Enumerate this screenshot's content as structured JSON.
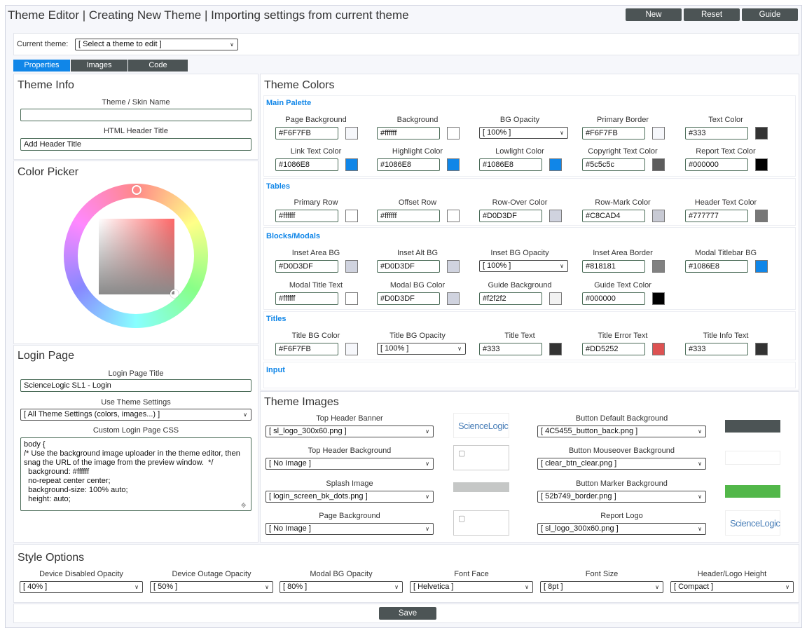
{
  "header": {
    "title": "Theme Editor | Creating New Theme | Importing settings from current theme",
    "buttons": {
      "new": "New",
      "reset": "Reset",
      "guide": "Guide"
    }
  },
  "current_theme": {
    "label": "Current theme:",
    "value": "[ Select a theme to edit ]"
  },
  "tabs": [
    "Properties",
    "Images",
    "Code"
  ],
  "theme_info": {
    "title": "Theme Info",
    "name_label": "Theme / Skin Name",
    "name_value": "",
    "html_title_label": "HTML Header Title",
    "html_title_value": "Add Header Title"
  },
  "color_picker": {
    "title": "Color Picker"
  },
  "login_page": {
    "title": "Login Page",
    "page_title_label": "Login Page Title",
    "page_title_value": "ScienceLogic SL1 - Login",
    "use_theme_label": "Use Theme Settings",
    "use_theme_value": "[ All Theme Settings (colors, images...) ]",
    "css_label": "Custom Login Page CSS",
    "css_value": "body {\n/* Use the background image uploader in the theme editor, then snag the URL of the image from the preview window.  */\n  background: #ffffff\n  no-repeat center center;\n  background-size: 100% auto;\n  height: auto;"
  },
  "theme_colors": {
    "title": "Theme Colors",
    "main_palette": {
      "title": "Main Palette",
      "fields": [
        {
          "label": "Page Background",
          "value": "#F6F7FB",
          "color": "#F6F7FB"
        },
        {
          "label": "Background",
          "value": "#ffffff",
          "color": "#ffffff"
        },
        {
          "label": "BG Opacity",
          "value": "[ 100% ]",
          "select": true
        },
        {
          "label": "Primary Border",
          "value": "#F6F7FB",
          "color": "#F6F7FB"
        },
        {
          "label": "Text Color",
          "value": "#333",
          "color": "#333333"
        },
        {
          "label": "Link Text Color",
          "value": "#1086E8",
          "color": "#1086E8"
        },
        {
          "label": "Highlight Color",
          "value": "#1086E8",
          "color": "#1086E8"
        },
        {
          "label": "Lowlight Color",
          "value": "#1086E8",
          "color": "#1086E8"
        },
        {
          "label": "Copyright Text Color",
          "value": "#5c5c5c",
          "color": "#5c5c5c"
        },
        {
          "label": "Report Text Color",
          "value": "#000000",
          "color": "#000000"
        }
      ]
    },
    "tables": {
      "title": "Tables",
      "fields": [
        {
          "label": "Primary Row",
          "value": "#ffffff",
          "color": "#ffffff"
        },
        {
          "label": "Offset Row",
          "value": "#ffffff",
          "color": "#ffffff"
        },
        {
          "label": "Row-Over Color",
          "value": "#D0D3DF",
          "color": "#D0D3DF"
        },
        {
          "label": "Row-Mark Color",
          "value": "#C8CAD4",
          "color": "#C8CAD4"
        },
        {
          "label": "Header Text Color",
          "value": "#777777",
          "color": "#777777"
        }
      ]
    },
    "blocks": {
      "title": "Blocks/Modals",
      "fields": [
        {
          "label": "Inset Area BG",
          "value": "#D0D3DF",
          "color": "#D0D3DF"
        },
        {
          "label": "Inset Alt BG",
          "value": "#D0D3DF",
          "color": "#D0D3DF"
        },
        {
          "label": "Inset BG Opacity",
          "value": "[ 100% ]",
          "select": true
        },
        {
          "label": "Inset Area Border",
          "value": "#818181",
          "color": "#818181"
        },
        {
          "label": "Modal Titlebar BG",
          "value": "#1086E8",
          "color": "#1086E8"
        },
        {
          "label": "Modal Title Text",
          "value": "#ffffff",
          "color": "#ffffff"
        },
        {
          "label": "Modal BG Color",
          "value": "#D0D3DF",
          "color": "#D0D3DF"
        },
        {
          "label": "Guide Background",
          "value": "#f2f2f2",
          "color": "#f2f2f2"
        },
        {
          "label": "Guide Text Color",
          "value": "#000000",
          "color": "#000000"
        }
      ]
    },
    "titles": {
      "title": "Titles",
      "fields": [
        {
          "label": "Title BG Color",
          "value": "#F6F7FB",
          "color": "#F6F7FB"
        },
        {
          "label": "Title BG Opacity",
          "value": "[ 100% ]",
          "select": true
        },
        {
          "label": "Title Text",
          "value": "#333",
          "color": "#333333"
        },
        {
          "label": "Title Error Text",
          "value": "#DD5252",
          "color": "#DD5252"
        },
        {
          "label": "Title Info Text",
          "value": "#333",
          "color": "#333333"
        }
      ]
    },
    "input": {
      "title": "Input"
    }
  },
  "theme_images": {
    "title": "Theme Images",
    "left": [
      {
        "label": "Top Header Banner",
        "value": "[ sl_logo_300x60.png ]",
        "preview": "logo"
      },
      {
        "label": "Top Header Background",
        "value": "[ No Image ]",
        "preview": "empty"
      },
      {
        "label": "Splash Image",
        "value": "[ login_screen_bk_dots.png ]",
        "preview": "splash"
      },
      {
        "label": "Page Background",
        "value": "[ No Image ]",
        "preview": "empty"
      }
    ],
    "right": [
      {
        "label": "Button Default Background",
        "value": "[ 4C5455_button_back.png ]",
        "preview": "dark"
      },
      {
        "label": "Button Mouseover Background",
        "value": "[ clear_btn_clear.png ]",
        "preview": "clear"
      },
      {
        "label": "Button Marker Background",
        "value": "[ 52b749_border.png ]",
        "preview": "green"
      },
      {
        "label": "Report Logo",
        "value": "[ sl_logo_300x60.png ]",
        "preview": "logo"
      }
    ],
    "logo_text": "ScienceLogic"
  },
  "style_options": {
    "title": "Style Options",
    "fields": [
      {
        "label": "Device Disabled Opacity",
        "value": "[ 40% ]"
      },
      {
        "label": "Device Outage Opacity",
        "value": "[ 50% ]"
      },
      {
        "label": "Modal BG Opacity",
        "value": "[ 80% ]"
      },
      {
        "label": "Font Face",
        "value": "[ Helvetica ]"
      },
      {
        "label": "Font Size",
        "value": "[ 8pt ]"
      },
      {
        "label": "Header/Logo Height",
        "value": "[ Compact ]"
      }
    ]
  },
  "footer": {
    "save_label": "Save"
  }
}
